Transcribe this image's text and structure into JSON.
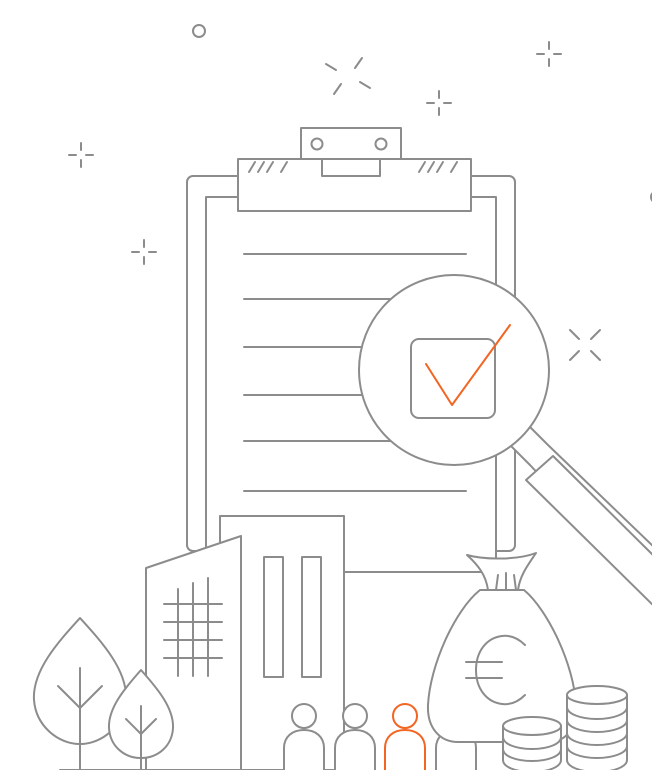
{
  "illustration": {
    "subject": "clipboard-audit-with-magnifier",
    "colors": {
      "line": "#8c8c8c",
      "accent": "#f26522",
      "background": "#ffffff"
    },
    "icons": [
      "clipboard-icon",
      "magnifying-glass-icon",
      "checkbox-checked-icon",
      "office-building-icon",
      "tree-icon",
      "person-icon",
      "money-bag-euro-icon",
      "coin-stack-icon",
      "sparkle-icon"
    ],
    "currency_symbol": "€",
    "people_count": 4,
    "highlighted_person_index": 2
  }
}
